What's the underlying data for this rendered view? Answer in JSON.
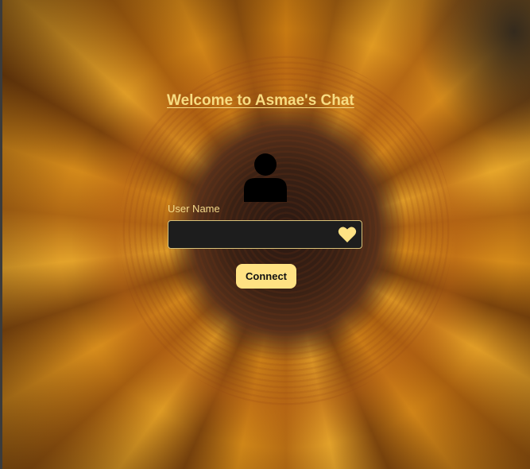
{
  "page": {
    "title": "Welcome to Asmae's Chat"
  },
  "form": {
    "username_label": "User Name",
    "username_value": "",
    "username_placeholder": "",
    "connect_label": "Connect"
  },
  "icons": {
    "avatar": "user-avatar-icon",
    "heart": "heart-icon"
  },
  "colors": {
    "accent": "#ffe283",
    "text": "#f3d98a",
    "input_bg": "#1d1d1d"
  }
}
